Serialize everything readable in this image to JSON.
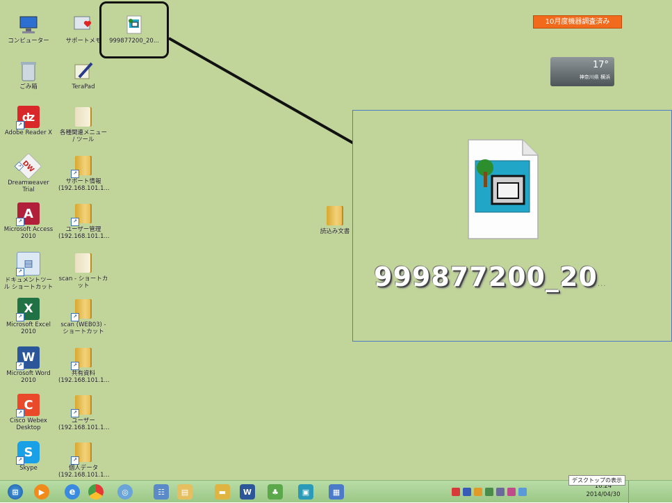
{
  "desktop": {
    "notice": "10月度機器調査済み",
    "weather": {
      "temp": "17°",
      "location": "神奈川県 横浜"
    },
    "icons": [
      {
        "label": "コンピューター",
        "icon": "computer-icon"
      },
      {
        "label": "サポートメモ",
        "icon": "heart-monitor-icon"
      },
      {
        "label": "999877200_20...",
        "icon": "document-window-icon"
      },
      {
        "label": "ごみ箱",
        "icon": "recycle-bin-icon"
      },
      {
        "label": "TeraPad",
        "icon": "terapad-icon"
      },
      {
        "label": "Adobe Reader X",
        "icon": "acrobat-icon"
      },
      {
        "label": "各種関連メニュー / ツール",
        "icon": "folder-icon"
      },
      {
        "label": "Dreamweaver Trial",
        "icon": "dreamweaver-icon"
      },
      {
        "label": "サポート情報 (192.168.101.1...",
        "icon": "folder-icon"
      },
      {
        "label": "Microsoft Access 2010",
        "icon": "access-icon"
      },
      {
        "label": "ユーザー管理 (192.168.101.1...",
        "icon": "folder-icon"
      },
      {
        "label": "ドキュメントツール ショートカット",
        "icon": "doc-tool-icon"
      },
      {
        "label": "scan - ショートカット",
        "icon": "folder-icon"
      },
      {
        "label": "Microsoft Excel 2010",
        "icon": "excel-icon"
      },
      {
        "label": "scan (WEB03) - ショートカット",
        "icon": "folder-icon"
      },
      {
        "label": "Microsoft Word 2010",
        "icon": "word-icon"
      },
      {
        "label": "共有資料 (192.168.101.1...",
        "icon": "folder-icon"
      },
      {
        "label": "Cisco Webex Desktop",
        "icon": "c-app-icon"
      },
      {
        "label": "ユーザー (192.168.101.1...",
        "icon": "folder-icon"
      },
      {
        "label": "Skype",
        "icon": "skype-icon"
      },
      {
        "label": "個人データ (192.168.101.1...",
        "icon": "folder-icon"
      },
      {
        "label": "読込み文書",
        "icon": "folder-icon"
      }
    ]
  },
  "zoom": {
    "label_main": "999877200_20",
    "label_tail": "...",
    "icon": "document-window-icon"
  },
  "taskbar": {
    "buttons": [
      "start-orb-icon",
      "media-player-icon",
      "internet-explorer-icon",
      "chrome-icon",
      "network-icon",
      "calendar-app-icon",
      "explorer-icon",
      "folder-app-icon",
      "word-icon",
      "tree-app-icon",
      "window-app-icon",
      "screen-app-icon"
    ],
    "clock_time": "16:24",
    "clock_date": "2014/04/30",
    "show_desktop_tip": "デスクトップの表示"
  },
  "colors": {
    "desktop_bg": "#c1d59a",
    "notice_bg": "#f26b1d",
    "callout_border": "#111111",
    "zoom_border": "#4f7bc3"
  }
}
